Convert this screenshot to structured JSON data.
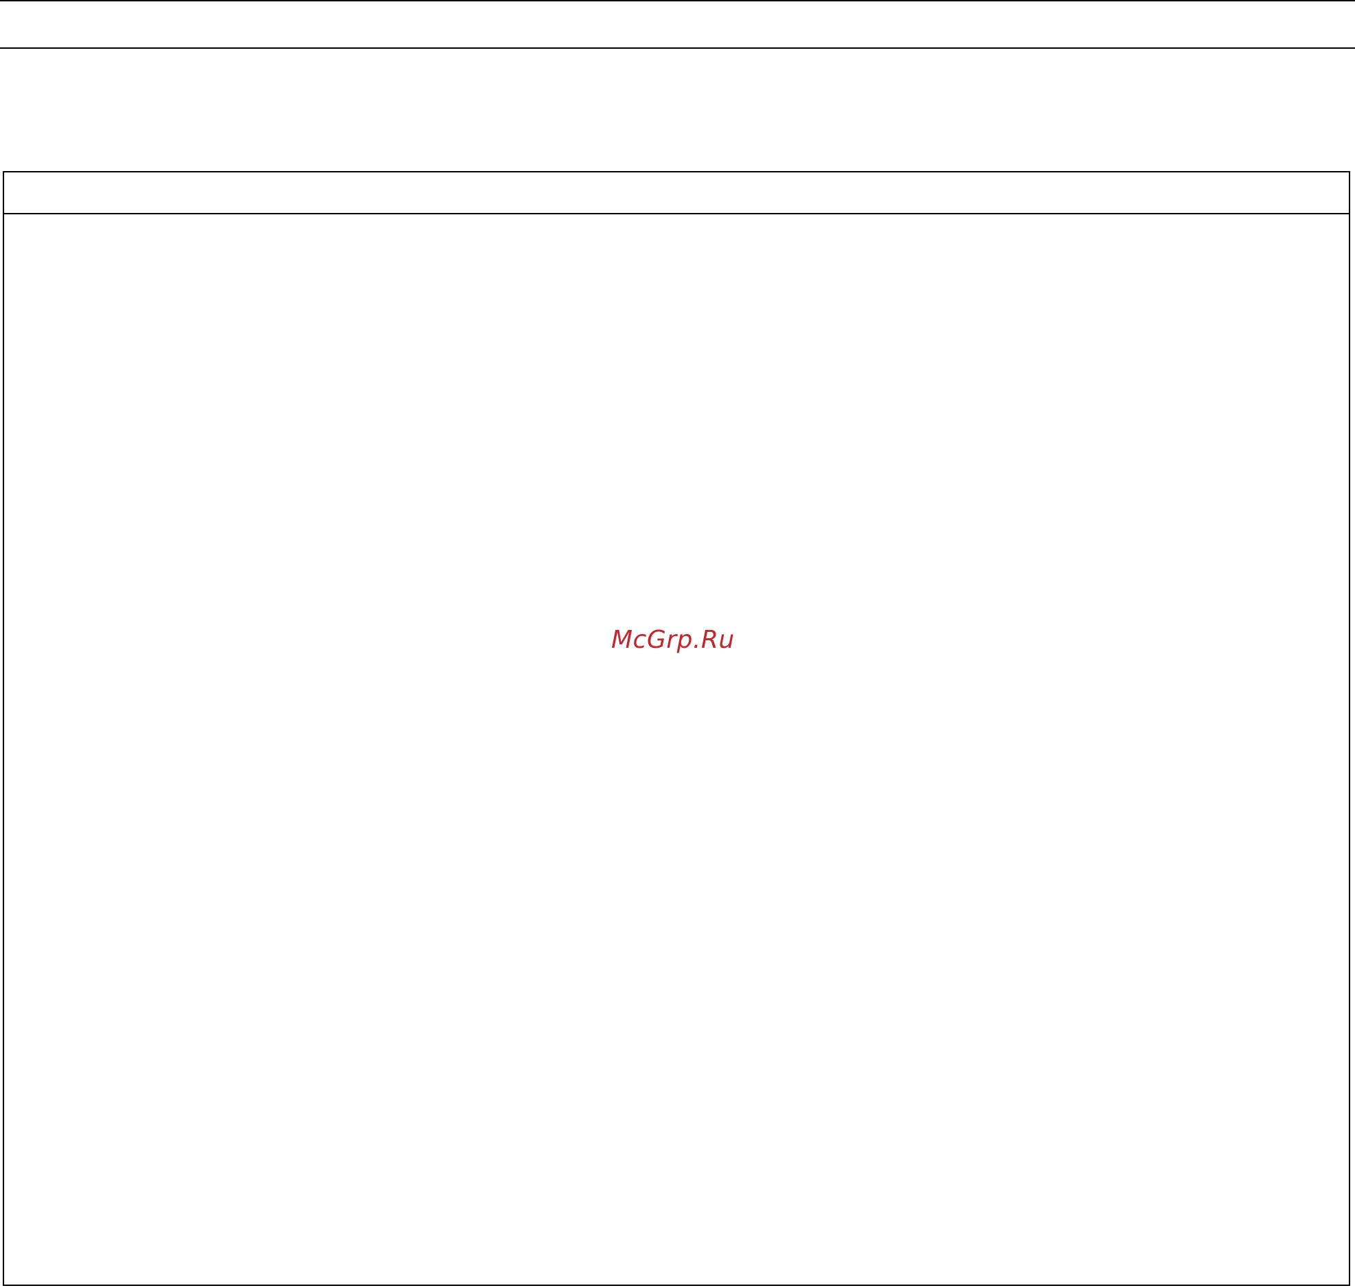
{
  "watermark": {
    "text": "McGrp.Ru",
    "color": "#c1272d"
  },
  "colors": {
    "background": "#ffffff",
    "rules": "#000000"
  }
}
